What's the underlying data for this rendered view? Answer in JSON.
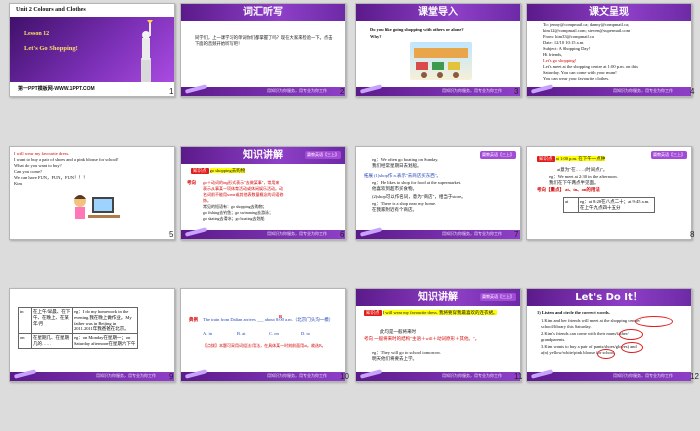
{
  "slides": [
    {
      "num": "1",
      "unit": "Unit 2  Colours and Clothes",
      "lesson": "Lesson 12",
      "title": "Let's Go Shopping!",
      "brand": "第一PPT模板网-WWW.1PPT.COM"
    },
    {
      "num": "2",
      "header": "词汇听写",
      "body": "同学们，上一课学习的单词你们都掌握了吗？现在大家来检验一下。点击下面的音频开始听写吧！"
    },
    {
      "num": "3",
      "header": "课堂导入",
      "q1": "Do you like going shopping with others or alone?",
      "q2": "Why?"
    },
    {
      "num": "4",
      "header": "课文呈现",
      "lines": [
        "To:   jenny@compmail.ca; danny@compmail.ca;",
        "        kim12@compmail.com; steven@supermail.com",
        "From:   kim33@compmail.ca",
        "Date:   12/10 10:15 a.m.",
        "Subject:   A Shopping Day!",
        "Hi friends,",
        "Let's go shopping!",
        "Let's meet at the shopping centre at 1:00 p.m. on this",
        "Saturday. You can come with your mum!",
        "You can wear your favourite clothes."
      ]
    },
    {
      "num": "5",
      "lines": [
        "I will wear my favourite dress.",
        "I want to buy a pair of shoes and a pink blouse for school!",
        "What do you want to buy?",
        "Can you come?",
        "We can have FUN，FUN，FUN！！！",
        "Kim"
      ]
    },
    {
      "num": "6",
      "header": "知识讲解",
      "point": "知识点",
      "point_text": "go shopping去购物",
      "label": "考向",
      "lines": [
        "go＋动词的ing形式表示\"去做某事\"，常用来",
        "表示从事某一项体育活动或休闲娱乐活动。动",
        "名词前不能用some或其他表数量概念的词语修",
        "饰。",
        "常见的短语有：go shopping去购物；",
        "go fishing去钓鱼；go swimming去游泳；",
        "go skating去滑冰；go boating去划船"
      ]
    },
    {
      "num": "7",
      "lines": [
        "eg：We often go boating on Sunday.",
        "      我们经常星期日去划船。",
        "拓展 (1)shop作 n.表示\"去商店买东西\"。",
        "eg：He likes to shop for food at the supermarket.",
        "      他喜欢到超市买食物。",
        "(2)shop可以作名词，意为\"商店\"，相当于store。",
        "eg：There is a shop near my home.",
        "      在我家附近有个商店。"
      ]
    },
    {
      "num": "8",
      "header": "知识讲解",
      "point": "知识点",
      "point_text": "at 1:00 p.m. 在下午一点钟",
      "lines": [
        "at意为\"在……(时间点)\"。",
        "eg：We meet at 2:30 in the afternoon.",
        "      我们在下午两点半见面。",
        "考向【重点】 at、in、on的用法"
      ],
      "table": [
        [
          "at",
          "eg：at 8:20在八点二十；at 9:45 a.m.在上午九点四十五分"
        ]
      ]
    },
    {
      "num": "9",
      "table": [
        [
          "in",
          "在上午/早晨、在下午、在晚上、在某年/月",
          "eg：I do my homework in the evening.我在晚上做作业。My father was in Beijing in 2011.2011年我爸爸在北京。"
        ],
        [
          "on",
          "在星期几、在星期几的……",
          "eg：on Monday在星期一；on Saturday afternoon在星期六下午"
        ]
      ]
    },
    {
      "num": "10",
      "label": "典例",
      "text": "The train from Dalian arrives ___ about 8:00 a.m.（北京门头沟一模）",
      "answer": "B",
      "options": [
        "A. in",
        "B. at",
        "C. on",
        "D. to"
      ],
      "note": "【点拨】本题可采用词组法/用法，在具体某一时刻前面用at。故选B。"
    },
    {
      "num": "11",
      "header": "知识讲解",
      "point": "知识点",
      "point_text": "I will wear my favourite dress. 我将要穿我最喜欢的连衣裙。",
      "lines": [
        "此句是一般将来时",
        "考向  一般将来时的结构\"主语＋will＋动词原形＋其他。\"。",
        "eg：They will go to school tomorrow.",
        "      明天他们将要去上学。"
      ]
    },
    {
      "num": "12",
      "header": "Let's Do It！",
      "title": "1) Listen and circle the correct words.",
      "lines": [
        "1.Kim and her friends will meet at the shopping centre/",
        "   school/library this Saturday.",
        "2.Kim's friends can come with their mum/father/",
        "   grandparents.",
        "3.Kim wants to buy a pair of pants/shoes/gloves) and",
        "   a(n) yellow/white/pink blouse for school."
      ]
    }
  ],
  "footer_text": "用知识为你服务，用专业为你工作",
  "tag_text": "冀教英语【三上】"
}
